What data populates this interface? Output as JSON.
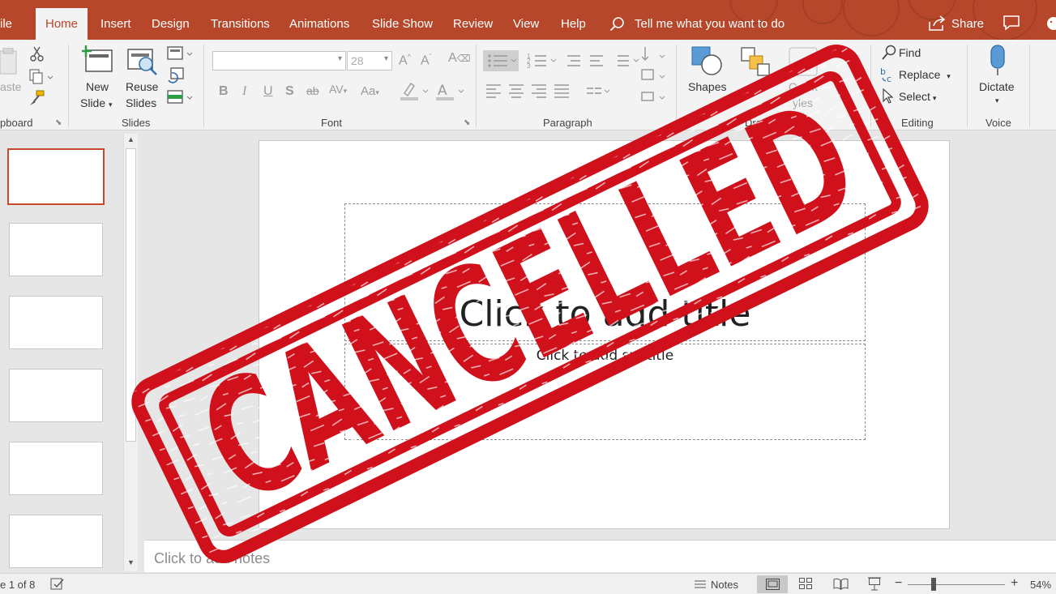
{
  "tabs": [
    "ile",
    "Home",
    "Insert",
    "Design",
    "Transitions",
    "Animations",
    "Slide Show",
    "Review",
    "View",
    "Help"
  ],
  "tell_me": "Tell me what you want to do",
  "share": "Share",
  "ribbon": {
    "clipboard": {
      "label": "pboard",
      "paste": "aste"
    },
    "slides": {
      "label": "Slides",
      "new_slide_1": "New",
      "new_slide_2": "Slide",
      "reuse_1": "Reuse",
      "reuse_2": "Slides"
    },
    "font": {
      "label": "Font",
      "font_name": "",
      "font_size": "28"
    },
    "paragraph": {
      "label": "Paragraph"
    },
    "drawing": {
      "label": "Drawing",
      "shapes": "Shapes",
      "quick_1": "Quick",
      "quick_2": "yles"
    },
    "editing": {
      "label": "Editing",
      "find": "Find",
      "replace": "Replace",
      "select": "Select"
    },
    "voice": {
      "label": "Voice",
      "dictate": "Dictate"
    }
  },
  "slide": {
    "title_placeholder": "Click to add title",
    "subtitle_placeholder": "Click to add subtitle"
  },
  "notes_placeholder": "Click to add notes",
  "status": {
    "slide_count": "e 1 of 8",
    "notes": "Notes",
    "zoom": "54%"
  },
  "stamp": {
    "text": "CANCELLED",
    "color": "#d0101b"
  },
  "colors": {
    "accent": "#b7472a",
    "selected_thumb": "#c94a2b"
  },
  "thumbnail_count": 6
}
